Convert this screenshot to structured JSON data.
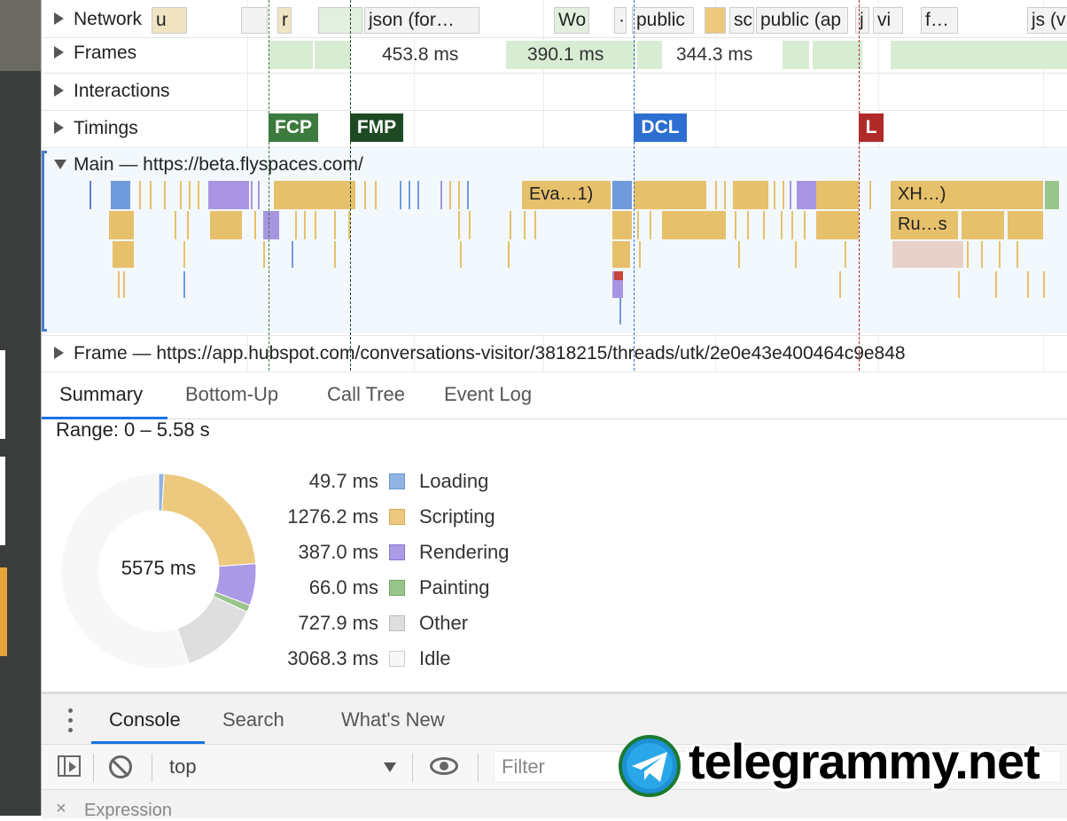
{
  "timeline": {
    "rows": {
      "network": "Network",
      "frames": "Frames",
      "interactions": "Interactions",
      "timings": "Timings",
      "main": "Main — https://beta.flyspaces.com/",
      "frame": "Frame — https://app.hubspot.com/conversations-visitor/3818215/threads/utk/2e0e43e400464c9e848"
    },
    "network_items": [
      "u",
      "r",
      "json (for…",
      "Wo",
      "·",
      "public",
      "sc",
      "public (ap",
      "j",
      "vi",
      "f…",
      "js (v"
    ],
    "frame_times": [
      "453.8 ms",
      "390.1 ms",
      "344.3 ms"
    ],
    "markers": {
      "fcp": {
        "label": "FCP",
        "color": "#3c7a3e"
      },
      "fmp": {
        "label": "FMP",
        "color": "#1e4a23"
      },
      "dcl": {
        "label": "DCL",
        "color": "#2d6fd1"
      },
      "load": {
        "label": "L",
        "color": "#b12a2a"
      }
    },
    "flame_labels": {
      "evaluate": "Eva…1)",
      "xhr": "XH…)",
      "run": "Ru…s"
    }
  },
  "summary_tabs": [
    "Summary",
    "Bottom-Up",
    "Call Tree",
    "Event Log"
  ],
  "summary": {
    "range": "Range: 0 – 5.58 s",
    "total": "5575 ms",
    "items": [
      {
        "value": "49.7 ms",
        "name": "Loading",
        "color": "#8fb4e3",
        "border": "#6c95cf",
        "ms": 49.7
      },
      {
        "value": "1276.2 ms",
        "name": "Scripting",
        "color": "#ecc97f",
        "border": "#d4aa55",
        "ms": 1276.2
      },
      {
        "value": "387.0 ms",
        "name": "Rendering",
        "color": "#ab9ae6",
        "border": "#8a75d3",
        "ms": 387.0
      },
      {
        "value": "66.0 ms",
        "name": "Painting",
        "color": "#99c58b",
        "border": "#74a865",
        "ms": 66.0
      },
      {
        "value": "727.9 ms",
        "name": "Other",
        "color": "#dedede",
        "border": "#bdbdbd",
        "ms": 727.9
      },
      {
        "value": "3068.3 ms",
        "name": "Idle",
        "color": "#f7f7f7",
        "border": "#cfcfcf",
        "ms": 3068.3
      }
    ]
  },
  "drawer": {
    "tabs": [
      "Console",
      "Search",
      "What's New"
    ],
    "context": "top",
    "filter_placeholder": "Filter",
    "expression": "Expression"
  },
  "watermark": "telegrammy.net"
}
